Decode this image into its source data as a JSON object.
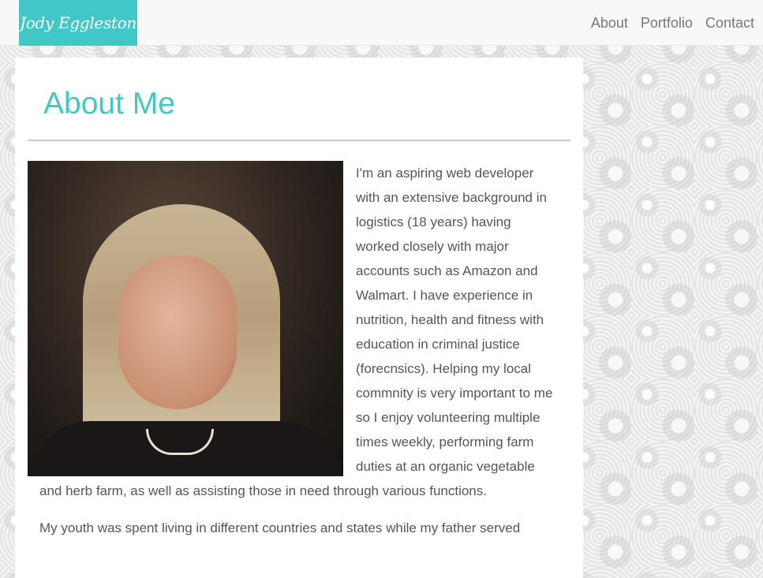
{
  "brand": "Jody Eggleston",
  "nav": {
    "items": [
      "About",
      "Portfolio",
      "Contact"
    ]
  },
  "about": {
    "title": "About Me",
    "photo_alt": "Portrait of Jody Eggleston",
    "paragraphs": [
      "I'm an aspiring web developer with an extensive background in logistics (18 years) having worked closely with major accounts such as Amazon and Walmart. I have experience in nutrition, health and fitness with education in criminal justice (forecnsics). Helping my local commnity is very important to me so I enjoy volunteering multiple times weekly, performing farm duties at an organic vegetable and herb farm, as well as assisting those in need through various functions.",
      "My youth was spent living in different countries and states while my father served"
    ]
  },
  "colors": {
    "accent": "#40c8c6",
    "text": "#555555",
    "nav_text": "#777777"
  }
}
